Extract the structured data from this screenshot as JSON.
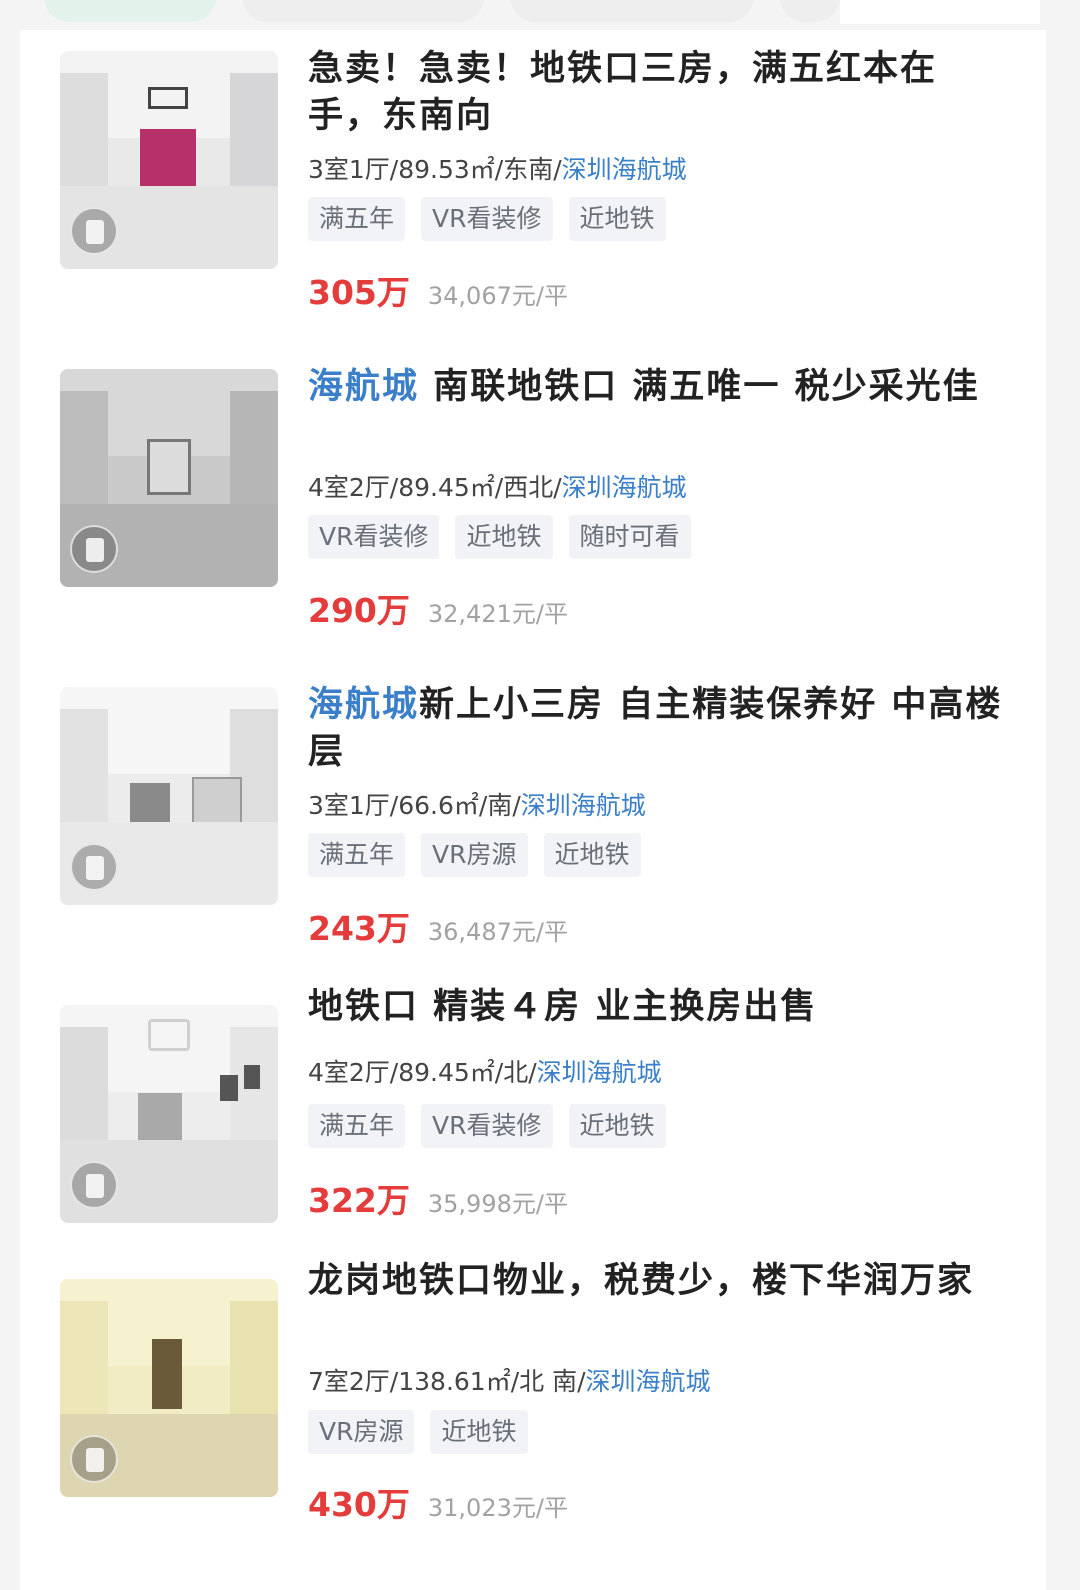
{
  "listings": [
    {
      "title_highlight": "",
      "title_rest": "急卖！急卖！地铁口三房，满五红本在手，东南向",
      "meta_prefix": "3室1厅/89.53㎡/东南/",
      "community": "深圳海航城",
      "tags": [
        "满五年",
        "VR看装修",
        "近地铁"
      ],
      "total_price": "305万",
      "unit_price": "34,067元/平"
    },
    {
      "title_highlight": "海航城",
      "title_rest": " 南联地铁口 满五唯一 税少采光佳",
      "meta_prefix": "4室2厅/89.45㎡/西北/",
      "community": "深圳海航城",
      "tags": [
        "VR看装修",
        "近地铁",
        "随时可看"
      ],
      "total_price": "290万",
      "unit_price": "32,421元/平"
    },
    {
      "title_highlight": "海航城",
      "title_rest": "新上小三房 自主精装保养好 中高楼层",
      "meta_prefix": "3室1厅/66.6㎡/南/",
      "community": "深圳海航城",
      "tags": [
        "满五年",
        "VR房源",
        "近地铁"
      ],
      "total_price": "243万",
      "unit_price": "36,487元/平"
    },
    {
      "title_highlight": "",
      "title_rest": "地铁口 精装４房 业主换房出售",
      "meta_prefix": "4室2厅/89.45㎡/北/",
      "community": "深圳海航城",
      "tags": [
        "满五年",
        "VR看装修",
        "近地铁"
      ],
      "total_price": "322万",
      "unit_price": "35,998元/平"
    },
    {
      "title_highlight": "",
      "title_rest": "龙岗地铁口物业，税费少，楼下华润万家",
      "meta_prefix": "7室2厅/138.61㎡/北 南/",
      "community": "深圳海航城",
      "tags": [
        "VR房源",
        "近地铁"
      ],
      "total_price": "430万",
      "unit_price": "31,023元/平"
    }
  ]
}
